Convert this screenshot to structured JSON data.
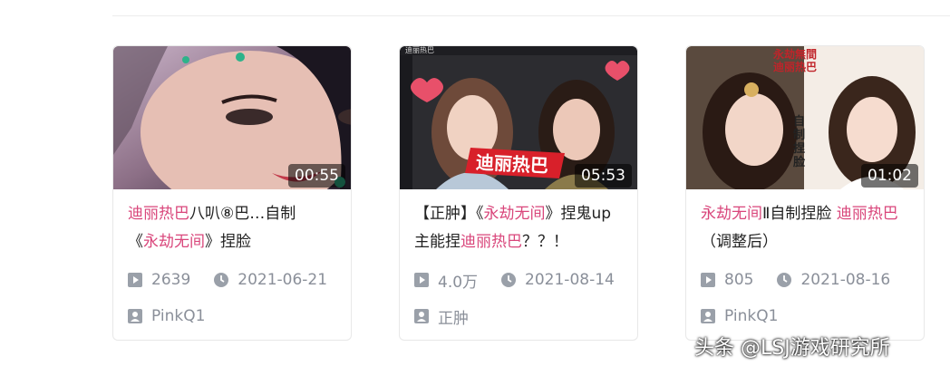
{
  "cards": [
    {
      "duration": "00:55",
      "title_parts": [
        {
          "text": "迪丽热巴",
          "hl": true
        },
        {
          "text": "八叭⑧巴…自制",
          "hl": false
        },
        {
          "text": "《",
          "hl": false
        },
        {
          "text": "永劫无间",
          "hl": true
        },
        {
          "text": "》捏脸",
          "hl": false
        }
      ],
      "views": "2639",
      "date": "2021-06-21",
      "author": "PinkQ1",
      "thumb_colors": {
        "bg": "#3a2f3a",
        "skin": "#e8c0b0",
        "hair": "#1b1620"
      }
    },
    {
      "duration": "05:53",
      "title_parts": [
        {
          "text": "【正肿】《",
          "hl": false
        },
        {
          "text": "永劫无间",
          "hl": true
        },
        {
          "text": "》捏鬼up主能捏",
          "hl": false
        },
        {
          "text": "迪丽热巴",
          "hl": true
        },
        {
          "text": "？？！",
          "hl": false
        }
      ],
      "views": "4.0万",
      "date": "2021-08-14",
      "author": "正肿",
      "thumb_label": "迪丽热巴",
      "thumb_topbar": "迪丽热巴",
      "thumb_colors": {
        "bg": "#2c2c30",
        "skin": "#f0d2c2",
        "hair": "#2a1c16"
      }
    },
    {
      "duration": "01:02",
      "title_parts": [
        {
          "text": "永劫无间",
          "hl": true
        },
        {
          "text": "Ⅱ自制捏脸 ",
          "hl": false
        },
        {
          "text": "迪丽热巴",
          "hl": true
        },
        {
          "text": "（调整后）",
          "hl": false
        }
      ],
      "views": "805",
      "date": "2021-08-16",
      "author": "PinkQ1",
      "thumb_side_text": "永劫無間 迪丽热巴",
      "thumb_side_text2": "自制捏脸",
      "thumb_colors": {
        "bg": "#d8c8b8",
        "skin": "#f2d6c8",
        "hair": "#2a1a14"
      }
    }
  ],
  "watermark": "头条 @LSJ游戏研究所",
  "colors": {
    "highlight": "#d9467b",
    "meta": "#8a8f99"
  }
}
